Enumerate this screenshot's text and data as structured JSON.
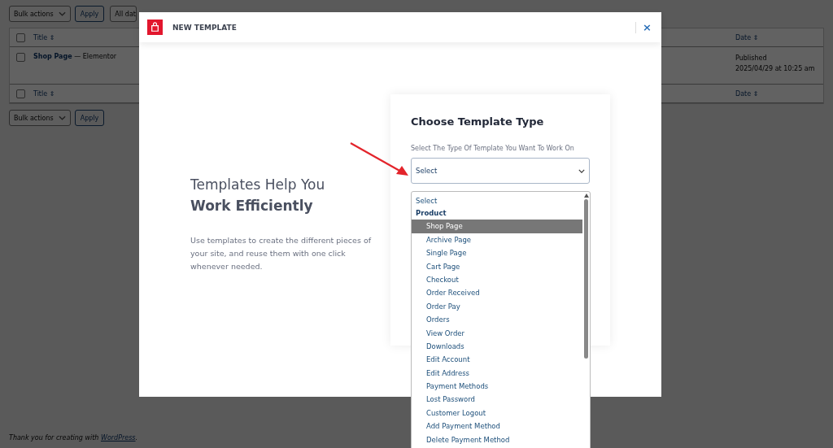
{
  "background": {
    "top_actions": {
      "bulk": "Bulk actions",
      "apply": "Apply",
      "dates": "All dat"
    },
    "header": {
      "checked": false,
      "title": "Title",
      "date": "Date",
      "sort_icon": "⇕"
    },
    "footer_header": {
      "checked": false,
      "title": "Title",
      "date": "Date",
      "sort_icon": "⇕"
    },
    "rows": [
      {
        "title": "Shop Page",
        "suffix": " — Elementor",
        "status": "Published",
        "date": "2025/04/29 at 10:25 am",
        "checked": false
      }
    ],
    "bottom_actions": {
      "bulk": "Bulk actions",
      "apply": "Apply"
    },
    "footer": {
      "text": "Thank you for creating with ",
      "link": "WordPress",
      "end": "."
    }
  },
  "modal": {
    "title": "NEW TEMPLATE",
    "close": "×",
    "heading_line1": "Templates Help You",
    "heading_line2": "Work Efficiently",
    "description": "Use templates to create the different pieces of your site, and reuse them with one click whenever needed.",
    "card": {
      "title": "Choose Template Type",
      "label": "Select The Type Of Template You Want To Work On",
      "select": {
        "value": "Select",
        "expanded": true
      },
      "options": [
        {
          "kind": "option",
          "label": "Select",
          "selected": false
        },
        {
          "kind": "group",
          "label": "Product"
        },
        {
          "kind": "option",
          "label": "Shop Page",
          "selected": true
        },
        {
          "kind": "option",
          "label": "Archive Page",
          "selected": false
        },
        {
          "kind": "option",
          "label": "Single Page",
          "selected": false
        },
        {
          "kind": "option",
          "label": "Cart Page",
          "selected": false
        },
        {
          "kind": "option",
          "label": "Checkout",
          "selected": false
        },
        {
          "kind": "option",
          "label": "Order Received",
          "selected": false
        },
        {
          "kind": "option",
          "label": "Order Pay",
          "selected": false
        },
        {
          "kind": "option",
          "label": "Orders",
          "selected": false
        },
        {
          "kind": "option",
          "label": "View Order",
          "selected": false
        },
        {
          "kind": "option",
          "label": "Downloads",
          "selected": false
        },
        {
          "kind": "option",
          "label": "Edit Account",
          "selected": false
        },
        {
          "kind": "option",
          "label": "Edit Address",
          "selected": false
        },
        {
          "kind": "option",
          "label": "Payment Methods",
          "selected": false
        },
        {
          "kind": "option",
          "label": "Lost Password",
          "selected": false
        },
        {
          "kind": "option",
          "label": "Customer Logout",
          "selected": false
        },
        {
          "kind": "option",
          "label": "Add Payment Method",
          "selected": false
        },
        {
          "kind": "option",
          "label": "Delete Payment Method",
          "selected": false
        }
      ]
    }
  }
}
